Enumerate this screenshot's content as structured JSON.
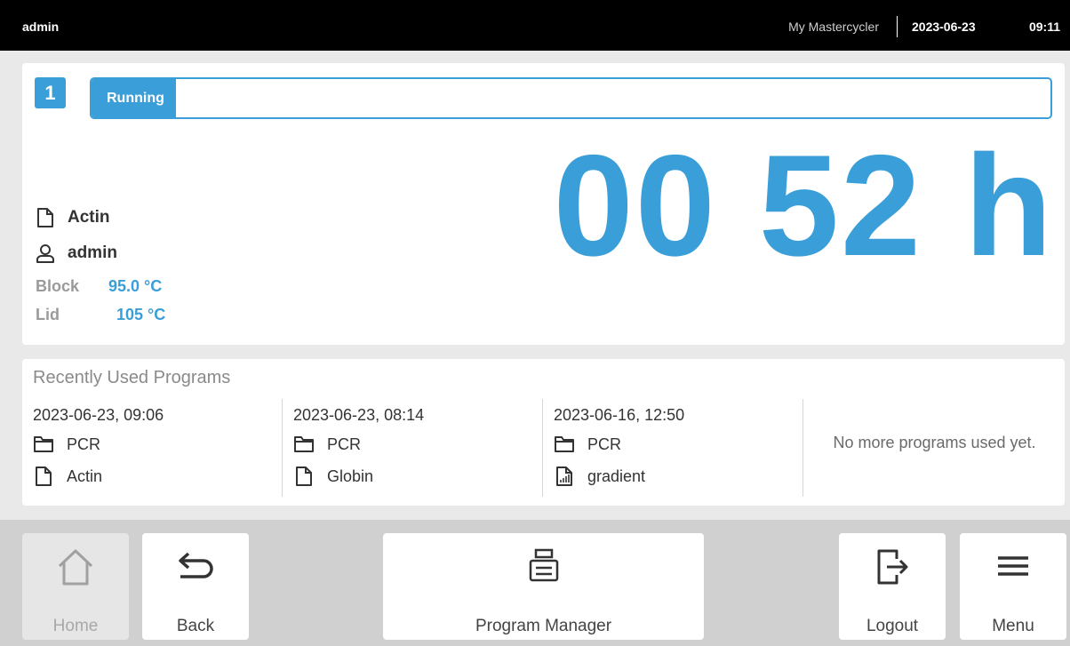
{
  "status_bar": {
    "user": "admin",
    "device_name": "My Mastercycler",
    "date": "2023-06-23",
    "time": "09:11"
  },
  "run": {
    "block_number": "1",
    "status": "Running",
    "progress_fraction": 0.088,
    "remaining_time": "00 52 h",
    "program": "Actin",
    "user": "admin",
    "block_label": "Block",
    "block_temp": "95.0 °C",
    "lid_label": "Lid",
    "lid_temp": "105 °C"
  },
  "recent": {
    "title": "Recently Used Programs",
    "programs": [
      {
        "datetime": "2023-06-23, 09:06",
        "folder": "PCR",
        "name": "Actin",
        "icon": "file-icon"
      },
      {
        "datetime": "2023-06-23, 08:14",
        "folder": "PCR",
        "name": "Globin",
        "icon": "file-icon"
      },
      {
        "datetime": "2023-06-16, 12:50",
        "folder": "PCR",
        "name": "gradient",
        "icon": "gradient-file-icon"
      }
    ],
    "empty_message": "No more programs used yet."
  },
  "nav": {
    "home": "Home",
    "back": "Back",
    "program_manager": "Program Manager",
    "logout": "Logout",
    "menu": "Menu"
  },
  "colors": {
    "accent": "#3a9fd8",
    "top_bar": "#000000",
    "nav_bar": "#d0d0d0"
  }
}
